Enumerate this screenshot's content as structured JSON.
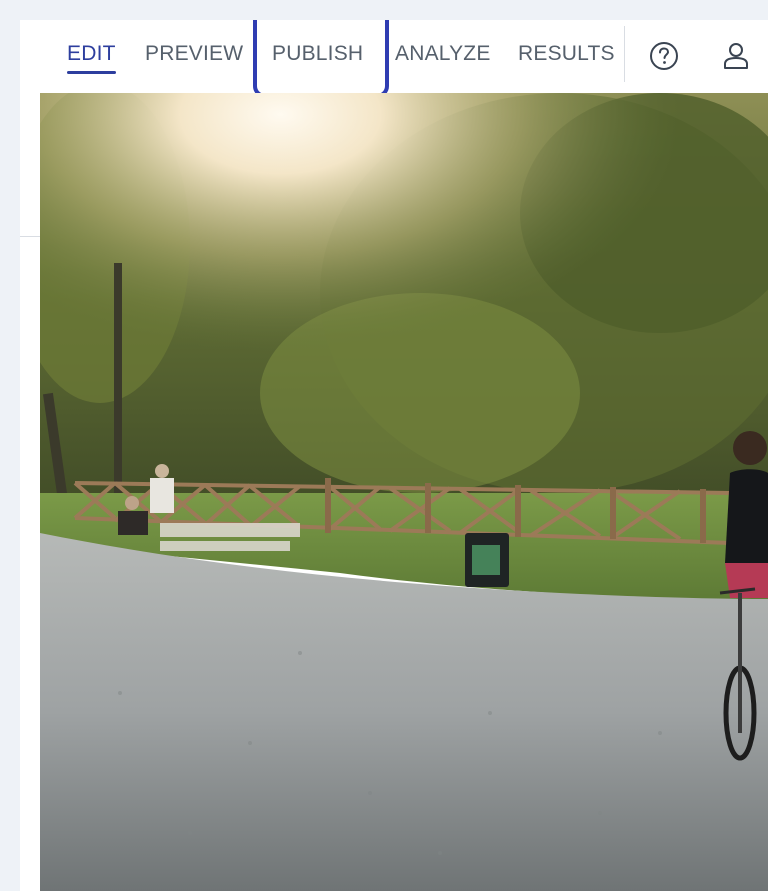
{
  "nav": {
    "tabs": [
      {
        "label": "EDIT",
        "active": true
      },
      {
        "label": "PREVIEW",
        "active": false
      },
      {
        "label": "PUBLISH",
        "active": false,
        "highlighted": true
      },
      {
        "label": "ANALYZE",
        "active": false
      },
      {
        "label": "RESULTS",
        "active": false
      }
    ],
    "icons": [
      "help-icon",
      "user-icon"
    ]
  },
  "colors": {
    "accent": "#2d3e9e",
    "highlight_border": "#2f3db2",
    "tab_text": "#56606c",
    "page_bg": "#eef2f7"
  },
  "image": {
    "subject": "photo"
  }
}
